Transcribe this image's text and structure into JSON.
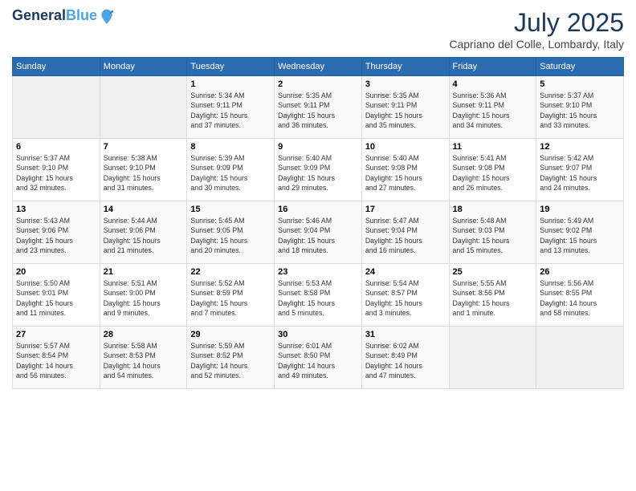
{
  "header": {
    "logo_line1": "General",
    "logo_line2": "Blue",
    "month": "July 2025",
    "location": "Capriano del Colle, Lombardy, Italy"
  },
  "weekdays": [
    "Sunday",
    "Monday",
    "Tuesday",
    "Wednesday",
    "Thursday",
    "Friday",
    "Saturday"
  ],
  "weeks": [
    [
      {
        "day": "",
        "info": ""
      },
      {
        "day": "",
        "info": ""
      },
      {
        "day": "1",
        "info": "Sunrise: 5:34 AM\nSunset: 9:11 PM\nDaylight: 15 hours\nand 37 minutes."
      },
      {
        "day": "2",
        "info": "Sunrise: 5:35 AM\nSunset: 9:11 PM\nDaylight: 15 hours\nand 36 minutes."
      },
      {
        "day": "3",
        "info": "Sunrise: 5:35 AM\nSunset: 9:11 PM\nDaylight: 15 hours\nand 35 minutes."
      },
      {
        "day": "4",
        "info": "Sunrise: 5:36 AM\nSunset: 9:11 PM\nDaylight: 15 hours\nand 34 minutes."
      },
      {
        "day": "5",
        "info": "Sunrise: 5:37 AM\nSunset: 9:10 PM\nDaylight: 15 hours\nand 33 minutes."
      }
    ],
    [
      {
        "day": "6",
        "info": "Sunrise: 5:37 AM\nSunset: 9:10 PM\nDaylight: 15 hours\nand 32 minutes."
      },
      {
        "day": "7",
        "info": "Sunrise: 5:38 AM\nSunset: 9:10 PM\nDaylight: 15 hours\nand 31 minutes."
      },
      {
        "day": "8",
        "info": "Sunrise: 5:39 AM\nSunset: 9:09 PM\nDaylight: 15 hours\nand 30 minutes."
      },
      {
        "day": "9",
        "info": "Sunrise: 5:40 AM\nSunset: 9:09 PM\nDaylight: 15 hours\nand 29 minutes."
      },
      {
        "day": "10",
        "info": "Sunrise: 5:40 AM\nSunset: 9:08 PM\nDaylight: 15 hours\nand 27 minutes."
      },
      {
        "day": "11",
        "info": "Sunrise: 5:41 AM\nSunset: 9:08 PM\nDaylight: 15 hours\nand 26 minutes."
      },
      {
        "day": "12",
        "info": "Sunrise: 5:42 AM\nSunset: 9:07 PM\nDaylight: 15 hours\nand 24 minutes."
      }
    ],
    [
      {
        "day": "13",
        "info": "Sunrise: 5:43 AM\nSunset: 9:06 PM\nDaylight: 15 hours\nand 23 minutes."
      },
      {
        "day": "14",
        "info": "Sunrise: 5:44 AM\nSunset: 9:06 PM\nDaylight: 15 hours\nand 21 minutes."
      },
      {
        "day": "15",
        "info": "Sunrise: 5:45 AM\nSunset: 9:05 PM\nDaylight: 15 hours\nand 20 minutes."
      },
      {
        "day": "16",
        "info": "Sunrise: 5:46 AM\nSunset: 9:04 PM\nDaylight: 15 hours\nand 18 minutes."
      },
      {
        "day": "17",
        "info": "Sunrise: 5:47 AM\nSunset: 9:04 PM\nDaylight: 15 hours\nand 16 minutes."
      },
      {
        "day": "18",
        "info": "Sunrise: 5:48 AM\nSunset: 9:03 PM\nDaylight: 15 hours\nand 15 minutes."
      },
      {
        "day": "19",
        "info": "Sunrise: 5:49 AM\nSunset: 9:02 PM\nDaylight: 15 hours\nand 13 minutes."
      }
    ],
    [
      {
        "day": "20",
        "info": "Sunrise: 5:50 AM\nSunset: 9:01 PM\nDaylight: 15 hours\nand 11 minutes."
      },
      {
        "day": "21",
        "info": "Sunrise: 5:51 AM\nSunset: 9:00 PM\nDaylight: 15 hours\nand 9 minutes."
      },
      {
        "day": "22",
        "info": "Sunrise: 5:52 AM\nSunset: 8:59 PM\nDaylight: 15 hours\nand 7 minutes."
      },
      {
        "day": "23",
        "info": "Sunrise: 5:53 AM\nSunset: 8:58 PM\nDaylight: 15 hours\nand 5 minutes."
      },
      {
        "day": "24",
        "info": "Sunrise: 5:54 AM\nSunset: 8:57 PM\nDaylight: 15 hours\nand 3 minutes."
      },
      {
        "day": "25",
        "info": "Sunrise: 5:55 AM\nSunset: 8:56 PM\nDaylight: 15 hours\nand 1 minute."
      },
      {
        "day": "26",
        "info": "Sunrise: 5:56 AM\nSunset: 8:55 PM\nDaylight: 14 hours\nand 58 minutes."
      }
    ],
    [
      {
        "day": "27",
        "info": "Sunrise: 5:57 AM\nSunset: 8:54 PM\nDaylight: 14 hours\nand 56 minutes."
      },
      {
        "day": "28",
        "info": "Sunrise: 5:58 AM\nSunset: 8:53 PM\nDaylight: 14 hours\nand 54 minutes."
      },
      {
        "day": "29",
        "info": "Sunrise: 5:59 AM\nSunset: 8:52 PM\nDaylight: 14 hours\nand 52 minutes."
      },
      {
        "day": "30",
        "info": "Sunrise: 6:01 AM\nSunset: 8:50 PM\nDaylight: 14 hours\nand 49 minutes."
      },
      {
        "day": "31",
        "info": "Sunrise: 6:02 AM\nSunset: 8:49 PM\nDaylight: 14 hours\nand 47 minutes."
      },
      {
        "day": "",
        "info": ""
      },
      {
        "day": "",
        "info": ""
      }
    ]
  ]
}
